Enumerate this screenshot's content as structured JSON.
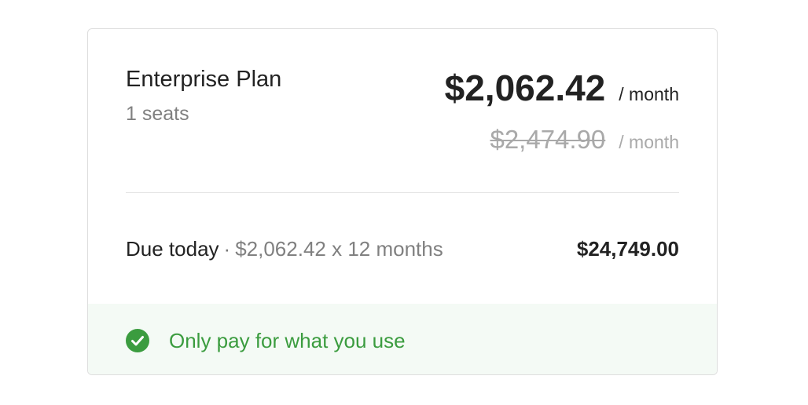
{
  "plan": {
    "name": "Enterprise Plan",
    "seats": "1 seats",
    "price": "$2,062.42",
    "price_period": "/ month",
    "original_price": "$2,474.90",
    "original_period": "/ month"
  },
  "due": {
    "label": "Due today",
    "separator": "·",
    "detail": "$2,062.42 x 12 months",
    "total": "$24,749.00"
  },
  "footer": {
    "icon": "check-circle-icon",
    "text": "Only pay for what you use"
  },
  "colors": {
    "accent_green": "#3b9c3f",
    "footer_bg": "#f4faf5",
    "text_dark": "#222222",
    "text_muted": "#808080"
  }
}
